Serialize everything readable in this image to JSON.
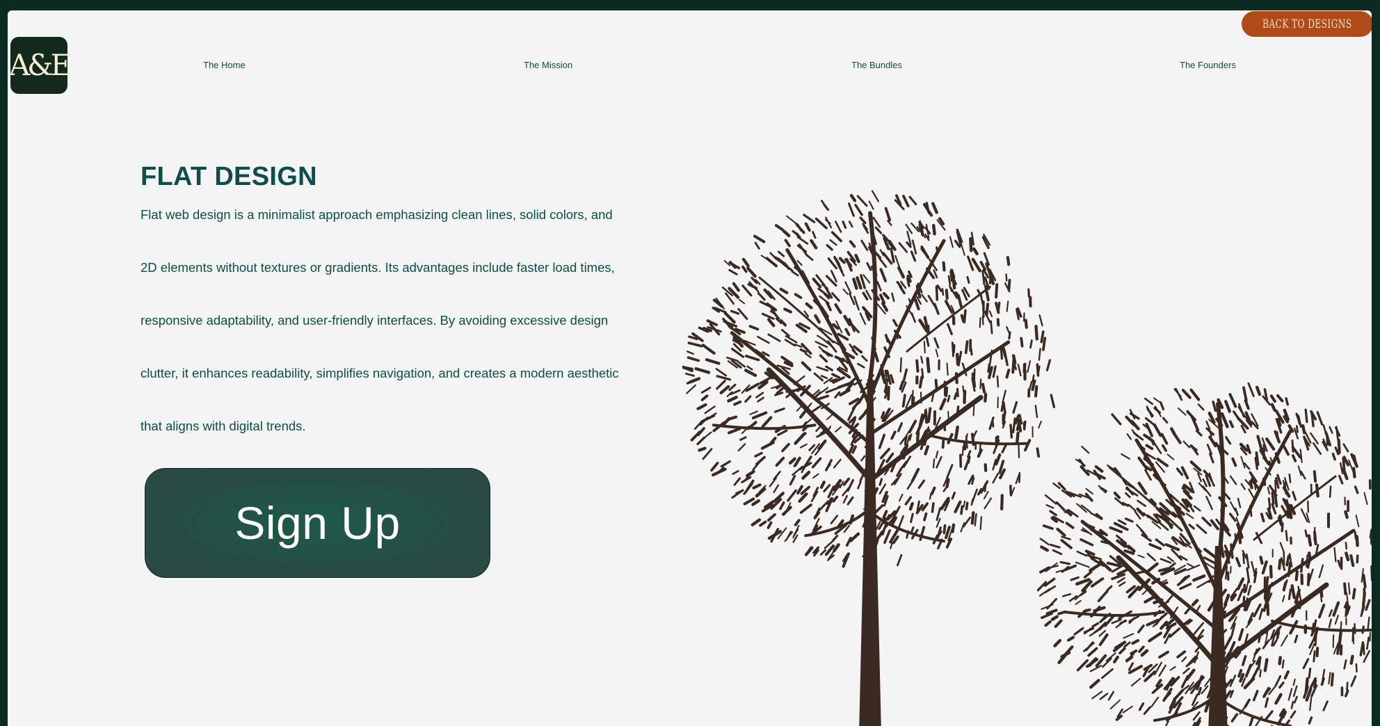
{
  "header": {
    "back_button_label": "BACK TO DESIGNS",
    "logo_text": "A&E",
    "nav": [
      {
        "label": "The Home"
      },
      {
        "label": "The Mission"
      },
      {
        "label": "The Bundles"
      },
      {
        "label": "The Founders"
      }
    ]
  },
  "hero": {
    "title": "FLAT DESIGN",
    "body_lines": [
      "Flat web design is a minimalist approach emphasizing clean lines, solid colors, and",
      "2D elements without textures or gradients. Its advantages include faster load times,",
      "responsive adaptability, and user-friendly interfaces. By avoiding excessive design",
      "clutter, it enhances readability, simplifies navigation, and creates a modern aesthetic",
      "that aligns with digital trends."
    ],
    "cta_label": "Sign Up"
  },
  "illustration": {
    "subject": "two-stylized-trees",
    "stroke_color": "#3a2a22"
  },
  "colors": {
    "frame": "#0b2a22",
    "page": "#f4f4f4",
    "accent_orange": "#b04a16",
    "text_teal": "#0e4d46",
    "button_green": "#1e5a49"
  }
}
